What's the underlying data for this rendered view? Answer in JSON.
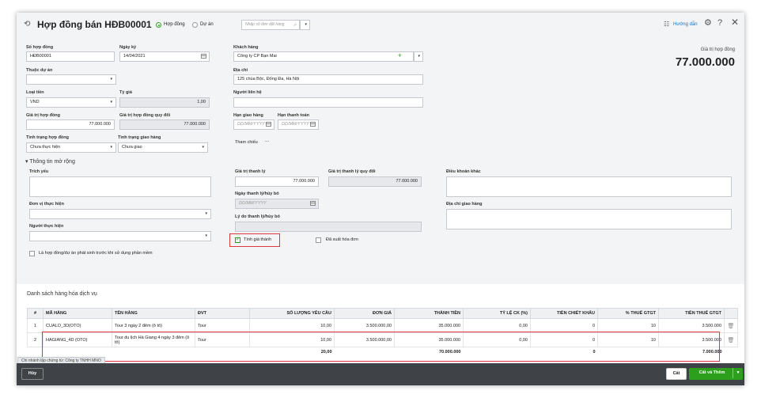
{
  "header": {
    "title": "Hợp đồng bán HĐB00001",
    "radio_contract": "Hợp đồng",
    "radio_project": "Dự án",
    "search_placeholder": "Nhập số đơn đặt hàng",
    "help_link": "Hướng dẫn"
  },
  "form": {
    "contract_no_label": "Số hợp đồng",
    "contract_no": "HĐB00001",
    "date_label": "Ngày ký",
    "date": "14/04/2021",
    "customer_label": "Khách hàng",
    "customer": "Công ty CP Bạn Mai",
    "project_label": "Thuộc dự án",
    "address_label": "Địa chỉ",
    "address": "125 chùa Bộc, Đống Đa, Hà Nội",
    "currency_label": "Loại tiền",
    "currency": "VND",
    "rate_label": "Tỷ giá",
    "rate": "1,00",
    "contact_label": "Người liên hệ",
    "value_label": "Giá trị hợp đồng",
    "value": "77.000.000",
    "value_conv_label": "Giá trị hợp đồng quy đổi",
    "value_conv": "77.000.000",
    "delivery_deadline_label": "Hạn giao hàng",
    "payment_deadline_label": "Hạn thanh toán",
    "date_placeholder": "DD/MM/YYYY",
    "contract_status_label": "Tình trạng hợp đồng",
    "contract_status": "Chưa thực hiện",
    "delivery_status_label": "Tình trạng giao hàng",
    "delivery_status": "Chưa giao",
    "reference_label": "Tham chiếu",
    "reference_value": "...",
    "summary_value_label": "Giá trị hợp đồng",
    "summary_value": "77.000.000"
  },
  "extended": {
    "toggle": "▾ Thông tin mở rộng",
    "abstract_label": "Trích yếu",
    "liq_value_label": "Giá trị thanh lý",
    "liq_value": "77.000.000",
    "liq_conv_label": "Giá trị thanh lý quy đổi",
    "liq_conv": "77.000.000",
    "terms_label": "Điều khoản khác",
    "unit_label": "Đơn vị thực hiện",
    "liq_date_label": "Ngày thanh lý/hủy bỏ",
    "delivery_addr_label": "Địa chỉ giao hàng",
    "performer_label": "Người thực hiện",
    "liq_reason_label": "Lý do thanh lý/hủy bỏ",
    "calc_cost_label": "Tính giá thành",
    "invoiced_label": "Đã xuất hóa đơn",
    "prior_label": "Là hợp đồng/dự án phát sinh trước khi sử dụng phần mềm"
  },
  "grid": {
    "title": "Danh sách hàng hóa dịch vụ",
    "columns": [
      "#",
      "MÃ HÀNG",
      "TÊN HÀNG",
      "ĐVT",
      "SỐ LƯỢNG YÊU CẦU",
      "ĐƠN GIÁ",
      "THÀNH TIỀN",
      "TỶ LỆ CK (%)",
      "TIỀN CHIẾT KHẤU",
      "% THUẾ GTGT",
      "TIỀN THUẾ GTGT"
    ],
    "rows": [
      [
        "1",
        "CUALO_3D(OTO)",
        "Tour 3 ngày 2 đêm (ô tô)",
        "Tour",
        "10,00",
        "3.500.000,00",
        "35.000.000",
        "0,00",
        "0",
        "10",
        "3.500.000"
      ],
      [
        "2",
        "HAGIANG_4D (OTO)",
        "Tour du lịch Hà Giang 4 ngày 3 đêm (ô tô)",
        "Tour",
        "10,00",
        "3.500.000,00",
        "35.000.000",
        "0,00",
        "0",
        "10",
        "3.500.000"
      ]
    ],
    "totals": [
      "",
      "",
      "",
      "",
      "20,00",
      "",
      "70.000.000",
      "",
      "0",
      "",
      "7.000.000"
    ],
    "branch_note": "Chi nhánh lập chứng từ: Công ty TNHH MNO"
  },
  "footer": {
    "cancel": "Hủy",
    "save": "Cất",
    "save_add": "Cất và Thêm"
  }
}
